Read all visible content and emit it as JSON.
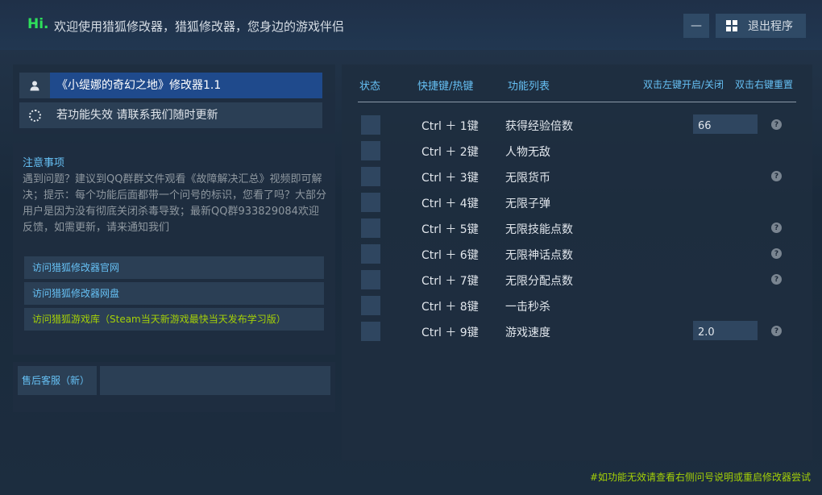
{
  "header": {
    "hi": "Hi.",
    "welcome": "欢迎使用猎狐修改器，猎狐修改器，您身边的游戏伴侣",
    "minimize_label": "—",
    "exit_label": "退出程序"
  },
  "title_panel": {
    "game_title": "《小缇娜的奇幻之地》修改器1.1",
    "notice": "若功能失效 请联系我们随时更新"
  },
  "notes": {
    "title": "注意事项",
    "body": "遇到问题？建议到QQ群群文件观看《故障解决汇总》视频即可解决；提示：每个功能后面都带一个问号的标识，您看了吗？大部分用户是因为没有彻底关闭杀毒导致；最新QQ群933829084欢迎反馈，如需更新，请来通知我们",
    "links": [
      "访问猎狐修改器官网",
      "访问猎狐修改器网盘",
      "访问猎狐游戏库（Steam当天新游戏最快当天发布学习版）"
    ]
  },
  "support": {
    "label": "售后客服（新）"
  },
  "table": {
    "headers": {
      "status": "状态",
      "hotkey": "快捷键/热键",
      "function": "功能列表",
      "toggle_hint": "双击左键开启/关闭",
      "reset_hint": "双击右键重置"
    },
    "rows": [
      {
        "hotkey": "Ctrl ＋ 1键",
        "name": "获得经验倍数",
        "value": "66",
        "help": "?"
      },
      {
        "hotkey": "Ctrl ＋ 2键",
        "name": "人物无敌"
      },
      {
        "hotkey": "Ctrl ＋ 3键",
        "name": "无限货币",
        "help": "?"
      },
      {
        "hotkey": "Ctrl ＋ 4键",
        "name": "无限子弹"
      },
      {
        "hotkey": "Ctrl ＋ 5键",
        "name": "无限技能点数",
        "help": "?"
      },
      {
        "hotkey": "Ctrl ＋ 6键",
        "name": "无限神话点数",
        "help": "?"
      },
      {
        "hotkey": "Ctrl ＋ 7键",
        "name": "无限分配点数",
        "help": "?"
      },
      {
        "hotkey": "Ctrl ＋ 8键",
        "name": "一击秒杀"
      },
      {
        "hotkey": "Ctrl ＋ 9键",
        "name": "游戏速度",
        "value": "2.0",
        "help": "?"
      }
    ]
  },
  "footer": {
    "note": "#如功能无效请查看右侧问号说明或重启修改器尝试"
  },
  "colors": {
    "accent_blue": "#66c0f4",
    "accent_green": "#a4d007",
    "hi_green": "#2ee05b",
    "selected_title_bg": "#1f4a8c"
  }
}
